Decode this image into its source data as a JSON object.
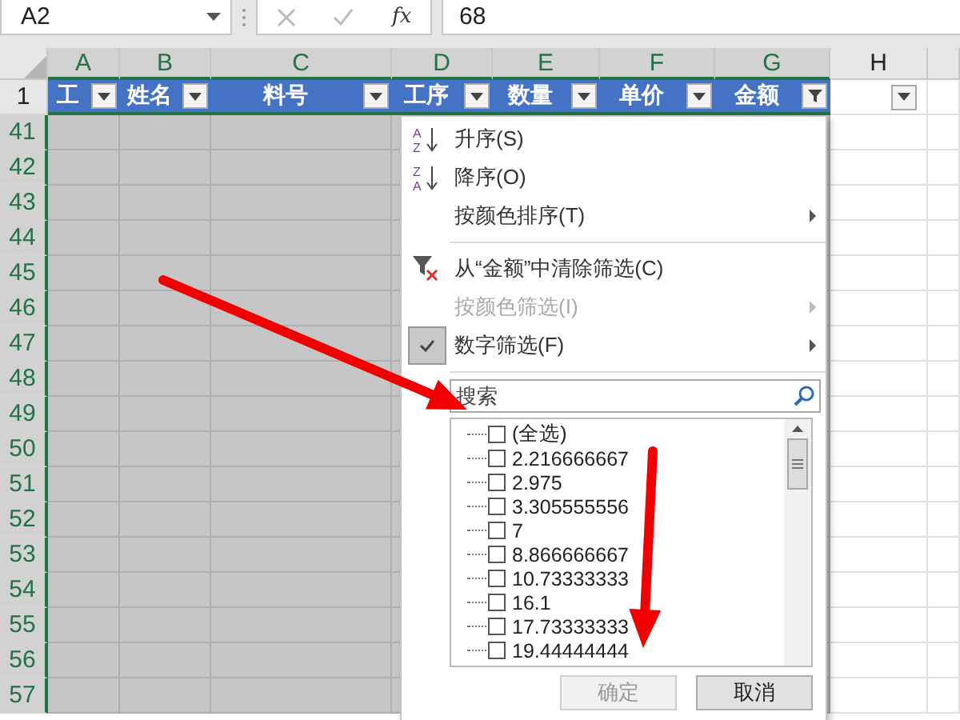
{
  "name_box": {
    "value": "A2"
  },
  "formula_bar": {
    "fx_label": "fx",
    "value": "68"
  },
  "columns": [
    {
      "label": "A",
      "selected": true
    },
    {
      "label": "B",
      "selected": true
    },
    {
      "label": "C",
      "selected": true
    },
    {
      "label": "D",
      "selected": true
    },
    {
      "label": "E",
      "selected": true
    },
    {
      "label": "F",
      "selected": true
    },
    {
      "label": "G",
      "selected": true
    },
    {
      "label": "H",
      "selected": false
    }
  ],
  "header_row": {
    "number": "1",
    "cells": [
      {
        "text": "工",
        "filtered": false
      },
      {
        "text": "姓名",
        "filtered": false
      },
      {
        "text": "料号",
        "filtered": false
      },
      {
        "text": "工序",
        "filtered": false
      },
      {
        "text": "数量",
        "filtered": false
      },
      {
        "text": "单价",
        "filtered": false
      },
      {
        "text": "金额",
        "filtered": true
      }
    ]
  },
  "rows": [
    {
      "number": "41",
      "selected": true
    },
    {
      "number": "42",
      "selected": true
    },
    {
      "number": "43",
      "selected": true
    },
    {
      "number": "44",
      "selected": true
    },
    {
      "number": "45",
      "selected": true
    },
    {
      "number": "46",
      "selected": true
    },
    {
      "number": "47",
      "selected": true
    },
    {
      "number": "48",
      "selected": true
    },
    {
      "number": "49",
      "selected": true
    },
    {
      "number": "50",
      "selected": true
    },
    {
      "number": "51",
      "selected": true
    },
    {
      "number": "52",
      "selected": true
    },
    {
      "number": "53",
      "selected": true
    },
    {
      "number": "54",
      "selected": true
    },
    {
      "number": "55",
      "selected": true
    },
    {
      "number": "56",
      "selected": true
    },
    {
      "number": "57",
      "selected": true
    }
  ],
  "filter_menu": {
    "items": [
      {
        "kind": "ascending",
        "icon_text": [
          "A",
          "Z"
        ],
        "label": "升序(S)",
        "disabled": false,
        "submenu": false,
        "checked": false
      },
      {
        "kind": "descending",
        "icon_text": [
          "Z",
          "A"
        ],
        "label": "降序(O)",
        "disabled": false,
        "submenu": false,
        "checked": false
      },
      {
        "kind": "command",
        "label": "按颜色排序(T)",
        "disabled": false,
        "submenu": true,
        "checked": false
      },
      {
        "kind": "separator"
      },
      {
        "kind": "clear",
        "label": "从“金额”中清除筛选(C)",
        "disabled": false,
        "submenu": false,
        "checked": false
      },
      {
        "kind": "command",
        "label": "按颜色筛选(I)",
        "disabled": true,
        "submenu": true,
        "checked": false
      },
      {
        "kind": "command",
        "label": "数字筛选(F)",
        "disabled": false,
        "submenu": true,
        "checked": true
      },
      {
        "kind": "separator"
      }
    ],
    "search": {
      "placeholder": "搜索"
    },
    "values": [
      {
        "label": "(全选)",
        "checked": false
      },
      {
        "label": "2.216666667",
        "checked": false
      },
      {
        "label": "2.975",
        "checked": false
      },
      {
        "label": "3.305555556",
        "checked": false
      },
      {
        "label": "7",
        "checked": false
      },
      {
        "label": "8.866666667",
        "checked": false
      },
      {
        "label": "10.73333333",
        "checked": false
      },
      {
        "label": "16.1",
        "checked": false
      },
      {
        "label": "17.73333333",
        "checked": false
      },
      {
        "label": "19.44444444",
        "checked": false
      }
    ],
    "buttons": [
      {
        "label": "确定",
        "disabled": true
      },
      {
        "label": "取消",
        "disabled": false
      }
    ]
  }
}
